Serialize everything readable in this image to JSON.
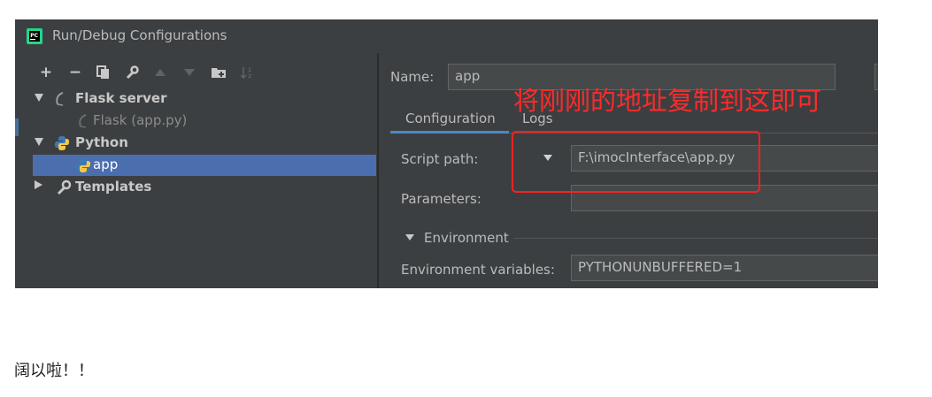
{
  "window": {
    "title": "Run/Debug Configurations"
  },
  "toolbar": {
    "icons": [
      "plus-icon",
      "minus-icon",
      "copy-icon",
      "wrench-icon",
      "move-up-icon",
      "move-down-icon",
      "folder-icon",
      "sort-icon"
    ]
  },
  "tree": {
    "flask_server": "Flask server",
    "flask_app": "Flask (app.py)",
    "python": "Python",
    "app": "app",
    "templates": "Templates"
  },
  "form": {
    "name_label": "Name:",
    "name_value": "app",
    "tabs": [
      "Configuration",
      "Logs"
    ],
    "script_path_label": "Script path:",
    "script_path_value": "F:\\imocInterface\\app.py",
    "parameters_label": "Parameters:",
    "parameters_value": "",
    "environment_label": "Environment",
    "env_vars_label": "Environment variables:",
    "env_vars_value": "PYTHONUNBUFFERED=1"
  },
  "annotation": {
    "text": "将刚刚的地址复制到这即可",
    "color": "#ff2a2a"
  },
  "caption": "阔以啦！！",
  "colors": {
    "background": "#3c3f41",
    "selection": "#4b6eaf",
    "tab_accent": "#4a88c7"
  }
}
